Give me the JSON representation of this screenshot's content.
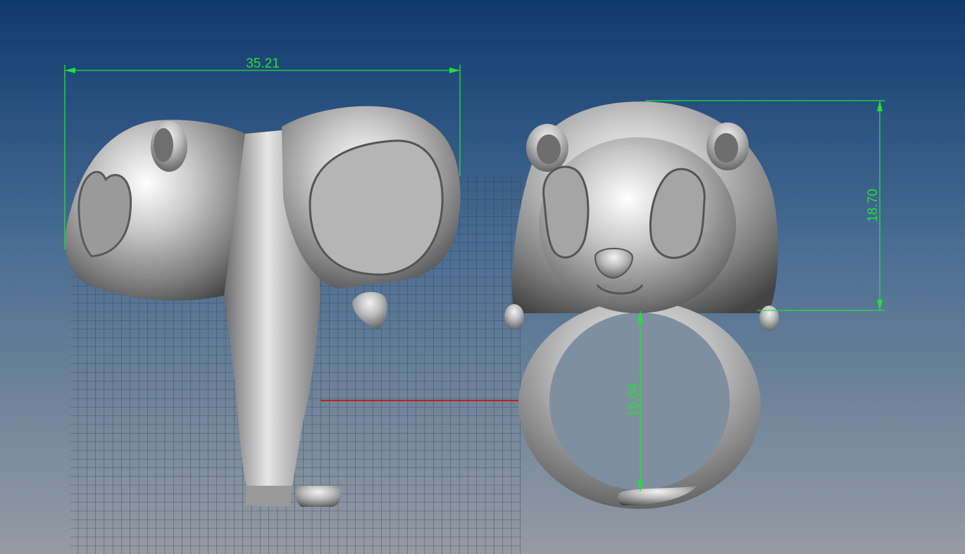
{
  "viewport": {
    "background_top": "#0f3a6e",
    "background_bottom": "#9098a0",
    "grid_color": "#3a3f45",
    "axis_x_color": "#c02020",
    "dimension_color": "#22e03a",
    "model_color": "#b8b8b8"
  },
  "dimensions": {
    "width": "35.21",
    "height": "18.70",
    "inner_diameter": "16.04"
  },
  "model": {
    "side_view": "side-view-ring-model",
    "front_view": "front-view-ring-model"
  }
}
